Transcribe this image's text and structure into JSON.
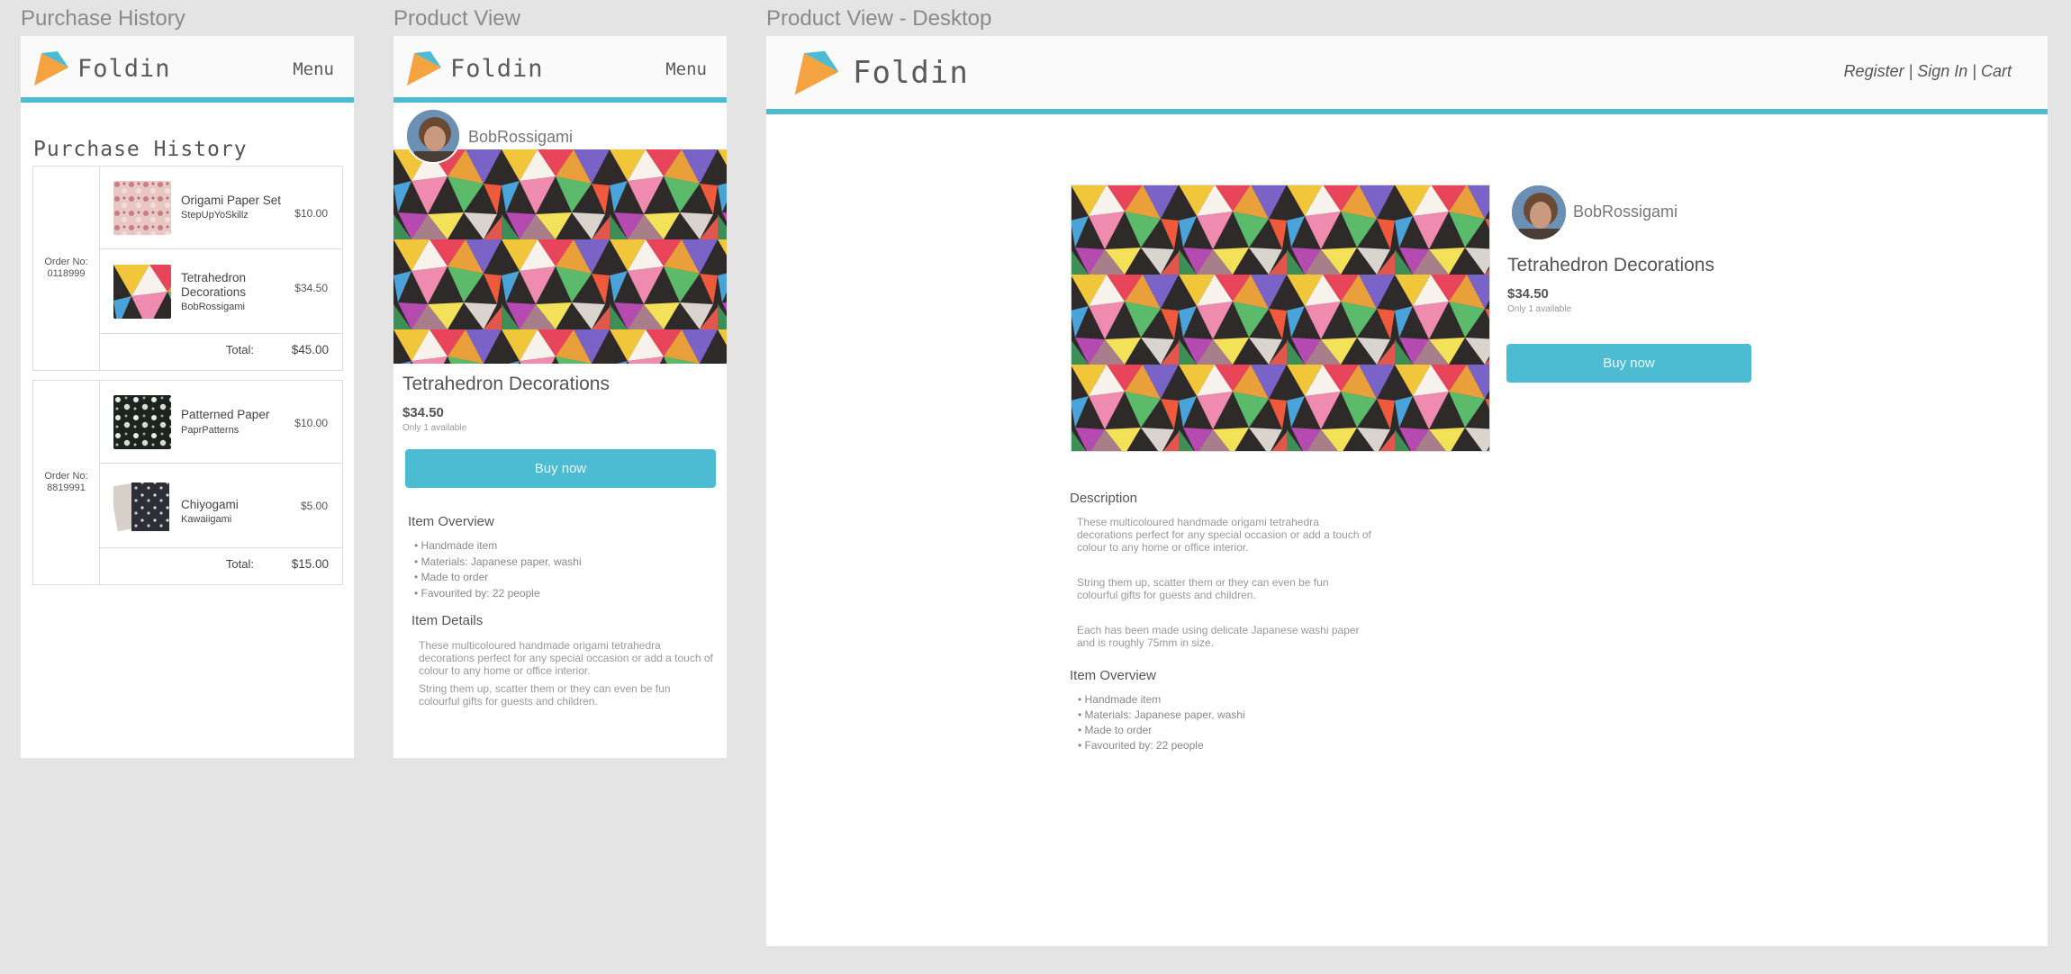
{
  "artboards": {
    "purchase_history": "Purchase History",
    "product_view": "Product View",
    "product_view_desktop": "Product View - Desktop"
  },
  "brand": {
    "name": "Foldin",
    "accent": "#4dbcd3",
    "logo_orange": "#f5a340",
    "logo_blue": "#4dbcd3"
  },
  "mobile_nav": {
    "menu_label": "Menu"
  },
  "desktop_nav": {
    "links": "Register | Sign In | Cart"
  },
  "purchase_history": {
    "title": "Purchase History",
    "orders": [
      {
        "order_label": "Order No:",
        "order_no": "0118999",
        "items": [
          {
            "name": "Origami Paper Set",
            "seller": "StepUpYoSkillz",
            "price": "$10.00",
            "thumb_icon": "origami-paper-set-thumb"
          },
          {
            "name": "Tetrahedron Decorations",
            "seller": "BobRossigami",
            "price": "$34.50",
            "thumb_icon": "tetrahedron-thumb"
          }
        ],
        "total_label": "Total:",
        "total": "$45.00"
      },
      {
        "order_label": "Order No:",
        "order_no": "8819991",
        "items": [
          {
            "name": "Patterned Paper",
            "seller": "PaprPatterns",
            "price": "$10.00",
            "thumb_icon": "patterned-paper-thumb"
          },
          {
            "name": "Chiyogami",
            "seller": "Kawaiigami",
            "price": "$5.00",
            "thumb_icon": "chiyogami-thumb"
          }
        ],
        "total_label": "Total:",
        "total": "$15.00"
      }
    ]
  },
  "product": {
    "seller": "BobRossigami",
    "title": "Tetrahedron Decorations",
    "price": "$34.50",
    "availability": "Only 1 available",
    "buy_label": "Buy now",
    "overview_title": "Item Overview",
    "overview": [
      "• Handmade item",
      "• Materials: Japanese paper, washi",
      "• Made to order",
      "• Favourited by: 22 people"
    ],
    "details_title": "Item Details",
    "mobile_details": [
      "These multicoloured handmade origami tetrahedra decorations perfect for any special occasion or add a touch of colour to any home or office interior.",
      "String them up, scatter them or they can even be fun colourful gifts for guests and children."
    ],
    "description_title": "Description",
    "description": [
      "These multicoloured handmade origami tetrahedra decorations perfect for any special occasion or add a touch of colour to any home or office interior.",
      "String them up, scatter them or they can even be fun colourful gifts for guests and children.",
      "Each has been made using delicate Japanese washi paper and is roughly 75mm in size."
    ]
  }
}
